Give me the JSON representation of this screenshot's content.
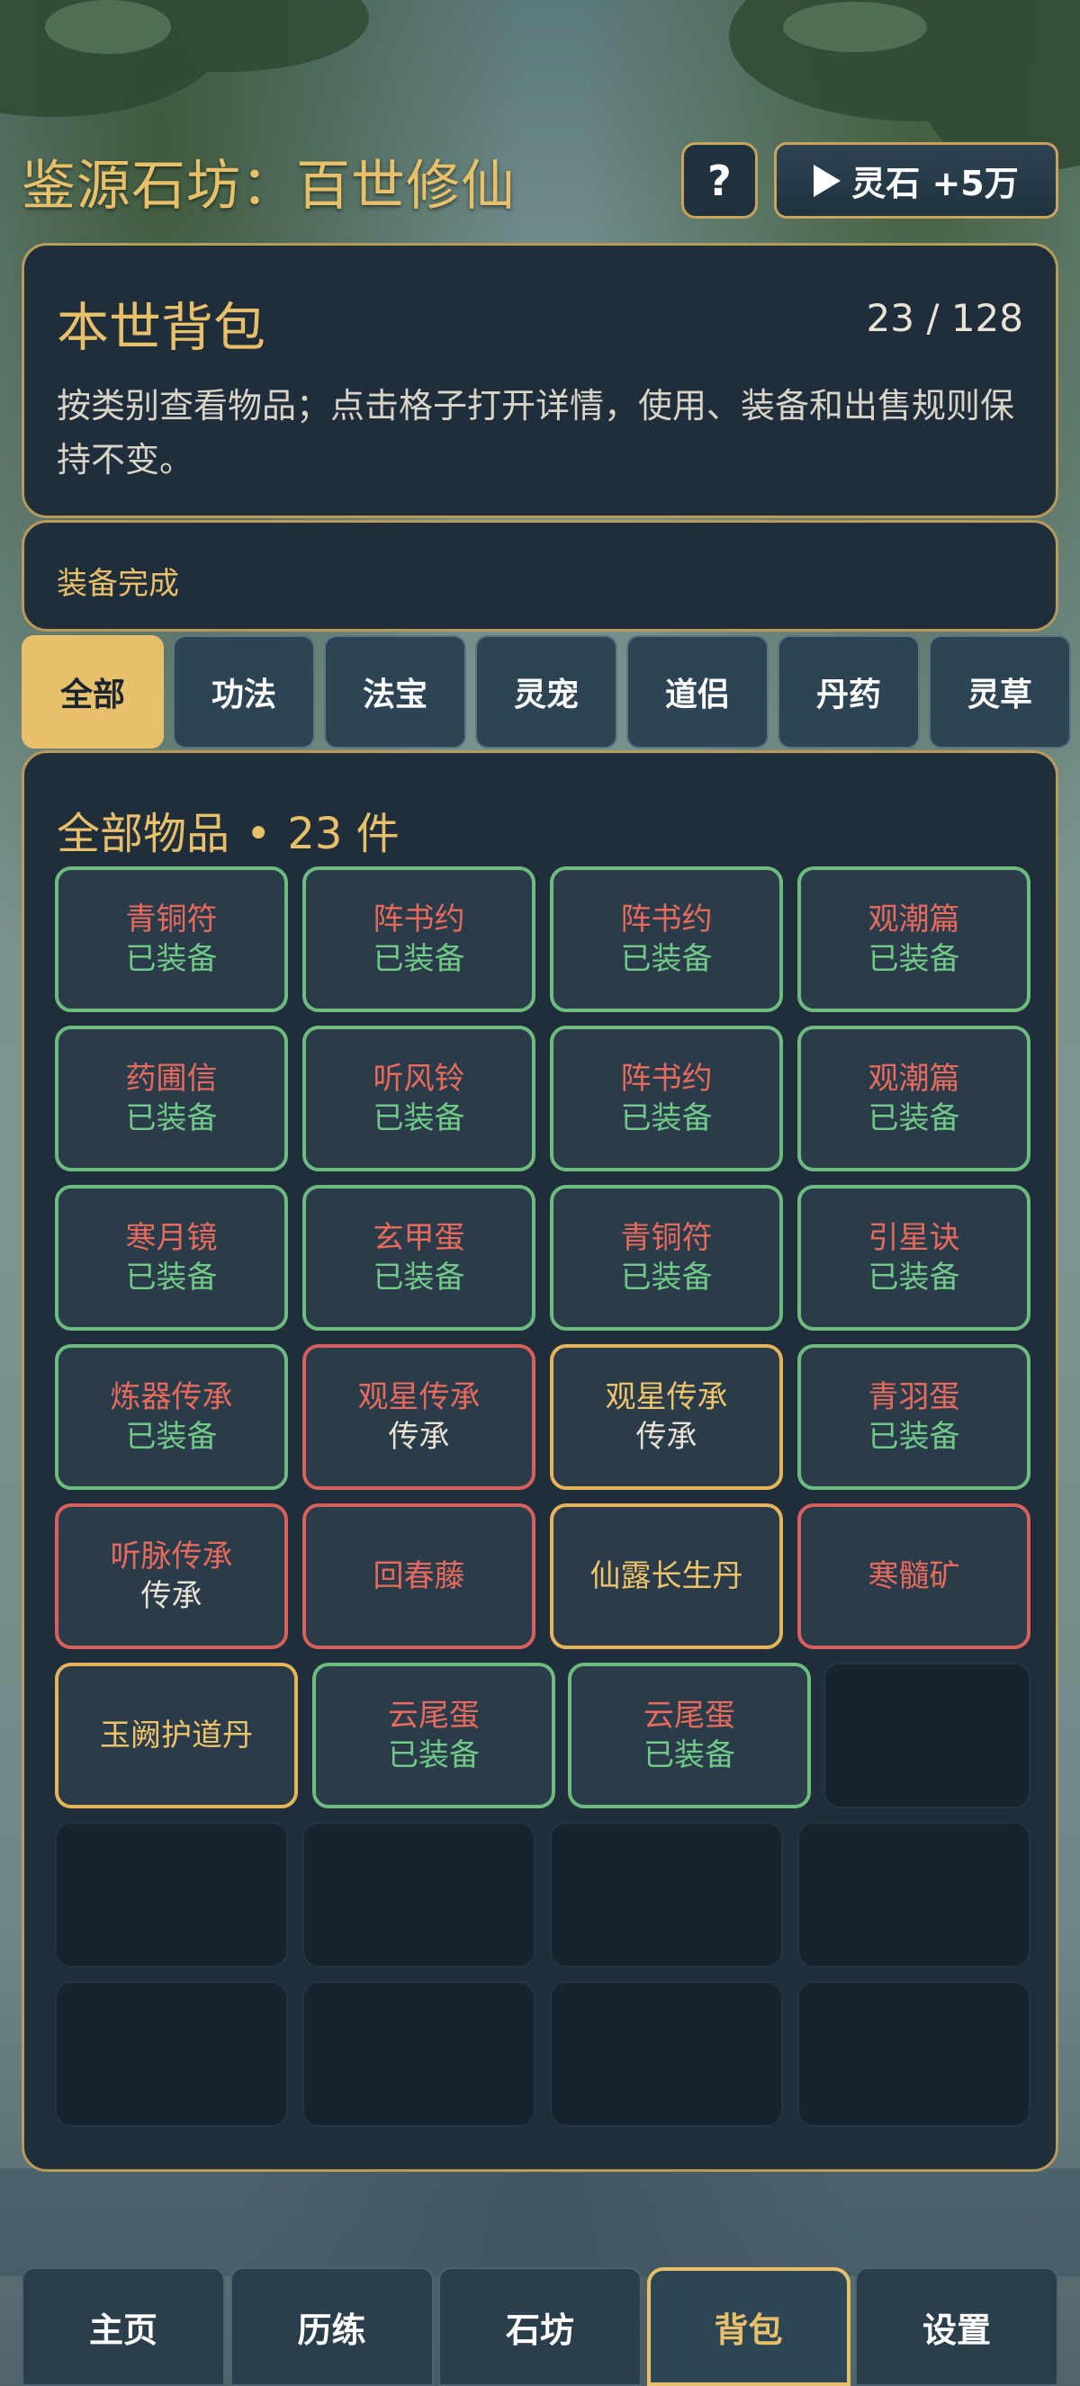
{
  "header": {
    "title": "鉴源石坊：百世修仙",
    "help_label": "?",
    "reward_label": "灵石 +5万"
  },
  "bag": {
    "title": "本世背包",
    "count": "23 / 128",
    "description": "按类别查看物品；点击格子打开详情，使用、装备和出售规则保持不变。"
  },
  "status_message": "装备完成",
  "tabs": [
    {
      "label": "全部",
      "active": true
    },
    {
      "label": "功法"
    },
    {
      "label": "法宝"
    },
    {
      "label": "灵宠"
    },
    {
      "label": "道侣"
    },
    {
      "label": "丹药"
    },
    {
      "label": "灵草"
    }
  ],
  "items_section": {
    "title": "全部物品",
    "separator": "•",
    "count_label": "23 件"
  },
  "items": [
    [
      {
        "name": "青铜符",
        "status": "已装备",
        "rarity": "green"
      },
      {
        "name": "阵书约",
        "status": "已装备",
        "rarity": "green"
      },
      {
        "name": "阵书约",
        "status": "已装备",
        "rarity": "green"
      },
      {
        "name": "观潮篇",
        "status": "已装备",
        "rarity": "green"
      }
    ],
    [
      {
        "name": "药圃信",
        "status": "已装备",
        "rarity": "green"
      },
      {
        "name": "听风铃",
        "status": "已装备",
        "rarity": "green"
      },
      {
        "name": "阵书约",
        "status": "已装备",
        "rarity": "green"
      },
      {
        "name": "观潮篇",
        "status": "已装备",
        "rarity": "green"
      }
    ],
    [
      {
        "name": "寒月镜",
        "status": "已装备",
        "rarity": "green"
      },
      {
        "name": "玄甲蛋",
        "status": "已装备",
        "rarity": "green"
      },
      {
        "name": "青铜符",
        "status": "已装备",
        "rarity": "green"
      },
      {
        "name": "引星诀",
        "status": "已装备",
        "rarity": "green"
      }
    ],
    [
      {
        "name": "炼器传承",
        "status": "已装备",
        "rarity": "green"
      },
      {
        "name": "观星传承",
        "status": "传承",
        "rarity": "red"
      },
      {
        "name": "观星传承",
        "status": "传承",
        "rarity": "gold"
      },
      {
        "name": "青羽蛋",
        "status": "已装备",
        "rarity": "green"
      }
    ],
    [
      {
        "name": "听脉传承",
        "status": "传承",
        "rarity": "red"
      },
      {
        "name": "回春藤",
        "status": "",
        "rarity": "red"
      },
      {
        "name": "仙露长生丹",
        "status": "",
        "rarity": "gold"
      },
      {
        "name": "寒髓矿",
        "status": "",
        "rarity": "red"
      }
    ],
    [
      {
        "name": "玉阙护道丹",
        "status": "",
        "rarity": "gold"
      },
      {
        "name": "云尾蛋",
        "status": "已装备",
        "rarity": "green"
      },
      {
        "name": "云尾蛋",
        "status": "已装备",
        "rarity": "green"
      },
      {
        "name": "",
        "status": "",
        "rarity": "empty"
      }
    ],
    [
      {
        "name": "",
        "status": "",
        "rarity": "empty"
      },
      {
        "name": "",
        "status": "",
        "rarity": "empty"
      },
      {
        "name": "",
        "status": "",
        "rarity": "empty"
      },
      {
        "name": "",
        "status": "",
        "rarity": "empty"
      }
    ],
    [
      {
        "name": "",
        "status": "",
        "rarity": "empty"
      },
      {
        "name": "",
        "status": "",
        "rarity": "empty"
      },
      {
        "name": "",
        "status": "",
        "rarity": "empty"
      },
      {
        "name": "",
        "status": "",
        "rarity": "empty"
      }
    ]
  ],
  "bottom_nav": [
    {
      "label": "主页"
    },
    {
      "label": "历练"
    },
    {
      "label": "石坊"
    },
    {
      "label": "背包",
      "active": true
    },
    {
      "label": "设置"
    }
  ],
  "colors": {
    "accent_gold": "#e8c06a",
    "panel_bg": "#1f2e3a",
    "equipped_green": "#72c888",
    "name_red": "#e86a5c",
    "border_red": "#d9605a",
    "border_gold": "#e6b45a"
  }
}
